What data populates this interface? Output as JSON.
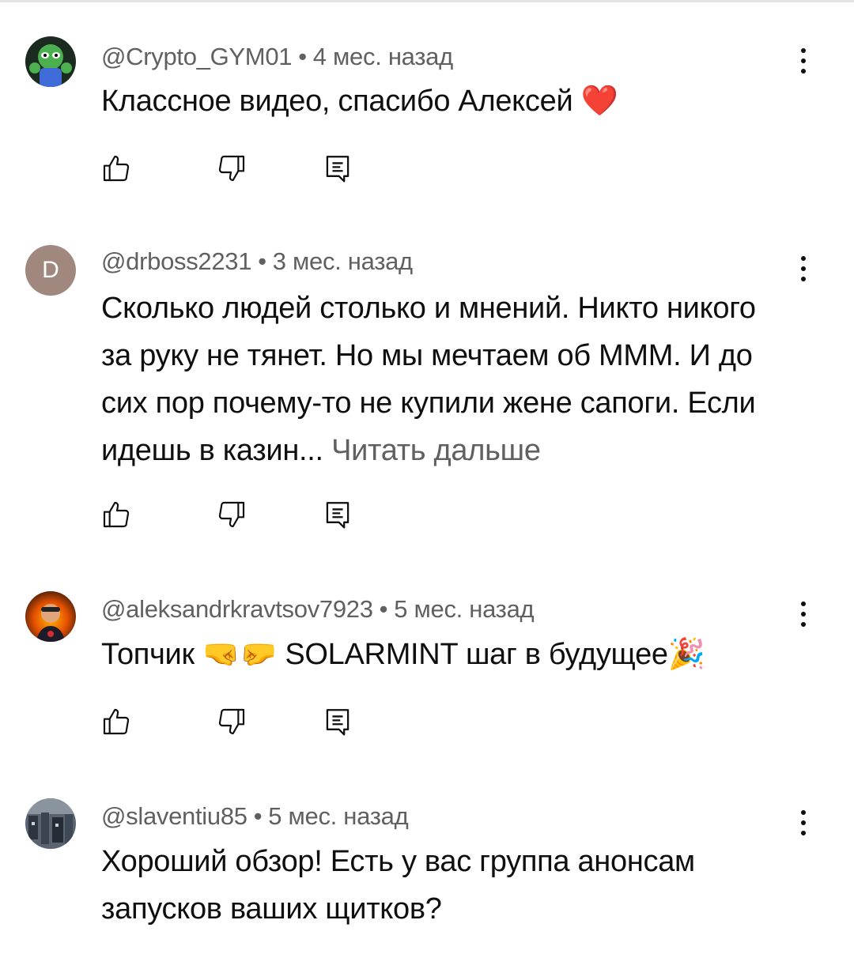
{
  "comments": [
    {
      "author": "@Crypto_GYM01",
      "time": "4 мес. назад",
      "text": "Классное видео, спасибо Алексей",
      "emoji": "❤️"
    },
    {
      "author": "@drboss2231",
      "time": "3 мес. назад",
      "avatar_letter": "D",
      "text": "Сколько людей столько и мнений. Никто никого за руку не тянет. Но мы мечтаем об МММ. И до сих пор почему-то не купили жене сапоги. Если идешь в казин...",
      "more_label": "Читать дальше"
    },
    {
      "author": "@aleksandrkravtsov7923",
      "time": "5 мес. назад",
      "text_before": "Топчик",
      "emoji_fists": "🤜🤛",
      "text_after": "SOLARMINT шаг в будущее",
      "emoji_party": "🎉"
    },
    {
      "author": "@slaventiu85",
      "time": "5 мес. назад",
      "text": "Хороший обзор! Есть у вас группа анонсам запусков ваших щитков?"
    }
  ],
  "separator": "•",
  "icons": {
    "like": "thumbs-up-icon",
    "dislike": "thumbs-down-icon",
    "reply": "reply-icon",
    "menu": "more-vert-icon"
  },
  "colors": {
    "text": "#0f0f0f",
    "meta": "#606060",
    "avatar_d": "#a1887f"
  }
}
